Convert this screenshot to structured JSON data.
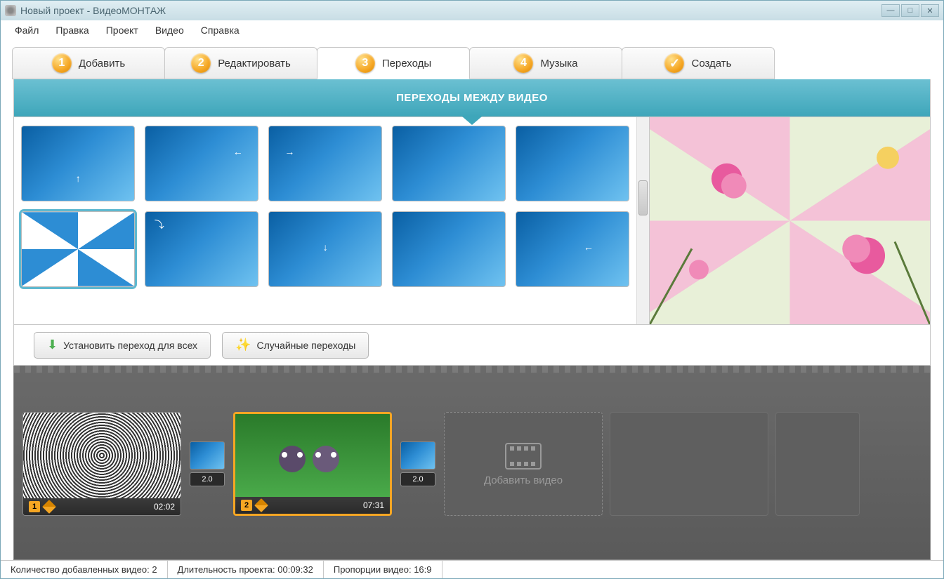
{
  "titlebar": {
    "title": "Новый проект - ВидеоМОНТАЖ"
  },
  "menu": {
    "file": "Файл",
    "edit": "Правка",
    "project": "Проект",
    "video": "Видео",
    "help": "Справка"
  },
  "tabs": {
    "add": {
      "num": "1",
      "label": "Добавить"
    },
    "edit": {
      "num": "2",
      "label": "Редактировать"
    },
    "trans": {
      "num": "3",
      "label": "Переходы"
    },
    "music": {
      "num": "4",
      "label": "Музыка"
    },
    "create": {
      "label": "Создать"
    }
  },
  "section": {
    "title": "ПЕРЕХОДЫ МЕЖДУ ВИДЕО"
  },
  "buttons": {
    "set_all": "Установить переход для всех",
    "random": "Случайные переходы"
  },
  "timeline": {
    "clip1": {
      "num": "1",
      "duration": "02:02"
    },
    "trans1": {
      "duration": "2.0"
    },
    "clip2": {
      "num": "2",
      "duration": "07:31"
    },
    "trans2": {
      "duration": "2.0"
    },
    "add_label": "Добавить видео"
  },
  "status": {
    "count_label": "Количество добавленных видео:",
    "count_value": "2",
    "length_label": "Длительность проекта:",
    "length_value": "00:09:32",
    "aspect_label": "Пропорции видео:",
    "aspect_value": "16:9"
  }
}
